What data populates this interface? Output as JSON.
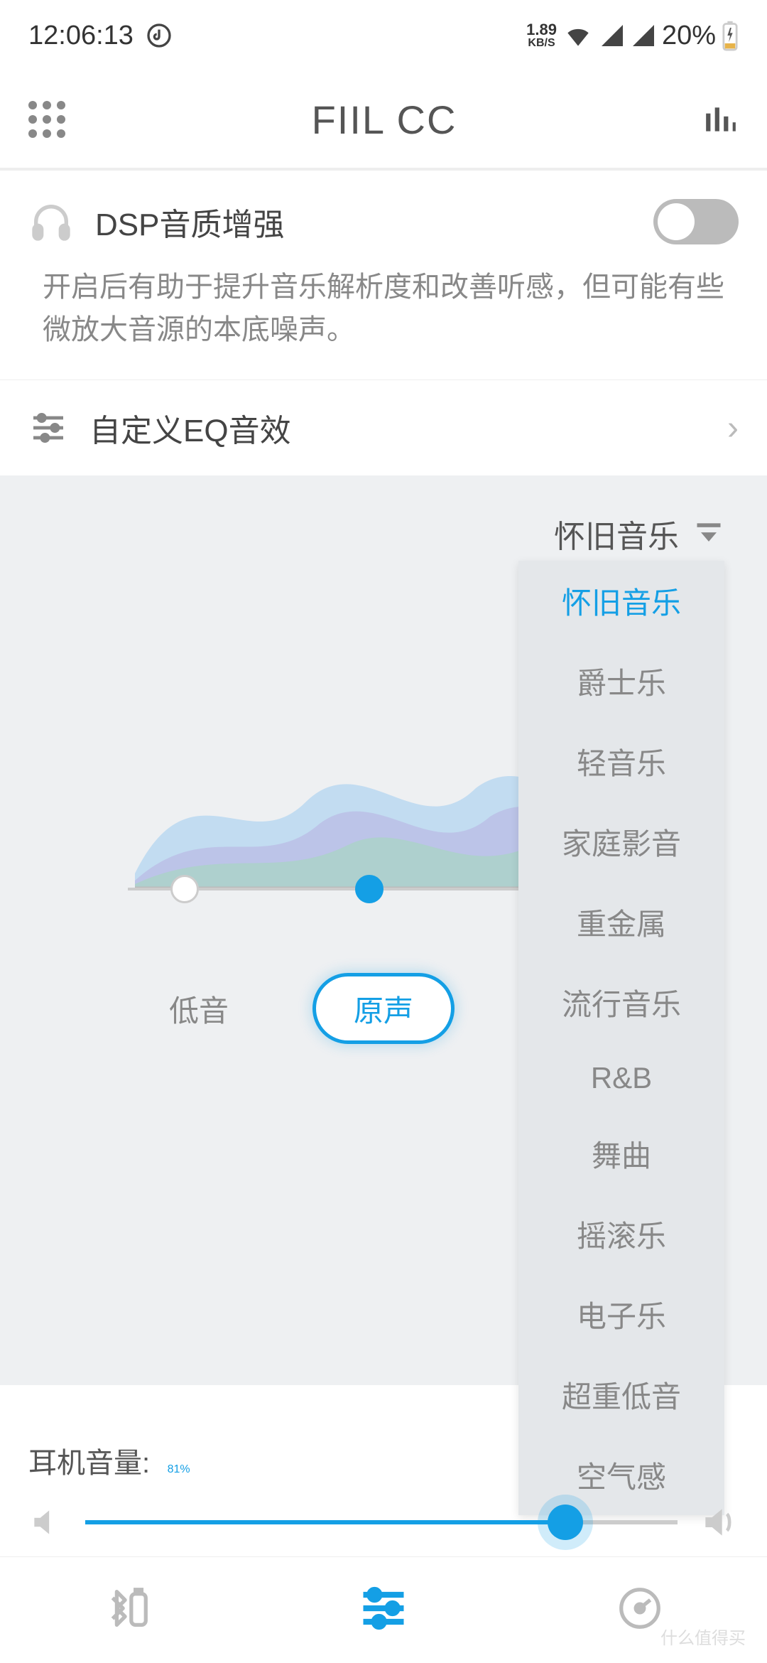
{
  "status": {
    "time": "12:06:13",
    "net_speed_value": "1.89",
    "net_speed_unit": "KB/S",
    "battery": "20%"
  },
  "header": {
    "title": "FIIL CC"
  },
  "dsp": {
    "label": "DSP音质增强",
    "description": "开启后有助于提升音乐解析度和改善听感，但可能有些微放大音源的本底噪声。",
    "enabled": false
  },
  "eq": {
    "label": "自定义EQ音效"
  },
  "preset": {
    "selected": "怀旧音乐",
    "options": [
      "怀旧音乐",
      "爵士乐",
      "轻音乐",
      "家庭影音",
      "重金属",
      "流行音乐",
      "R&B",
      "舞曲",
      "摇滚乐",
      "电子乐",
      "超重低音",
      "空气感"
    ]
  },
  "modes": {
    "bass": "低音",
    "original": "原声"
  },
  "volume": {
    "label": "耳机音量:",
    "value": "81%",
    "percent": 81
  },
  "watermark": "什么值得买",
  "colors": {
    "accent": "#149fe5"
  }
}
